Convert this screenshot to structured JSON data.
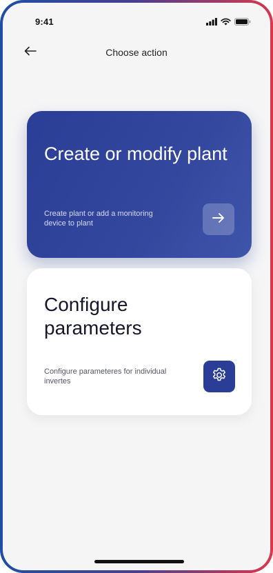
{
  "status_bar": {
    "time": "9:41"
  },
  "header": {
    "title": "Choose action",
    "back_icon": "arrow-left-icon"
  },
  "cards": [
    {
      "title": "Create or modify plant",
      "description": "Create plant or add a monitoring device to plant",
      "icon": "arrow-right-icon",
      "accent": "#2b3e97"
    },
    {
      "title": "Configure parameters",
      "description": "Configure parameteres for individual invertes",
      "icon": "gear-icon",
      "accent": "#2b3e97"
    }
  ],
  "colors": {
    "frame_gradient_start": "#1e4fa3",
    "frame_gradient_end": "#d8384c",
    "background": "#f5f5f6",
    "primary": "#2b3e97"
  }
}
